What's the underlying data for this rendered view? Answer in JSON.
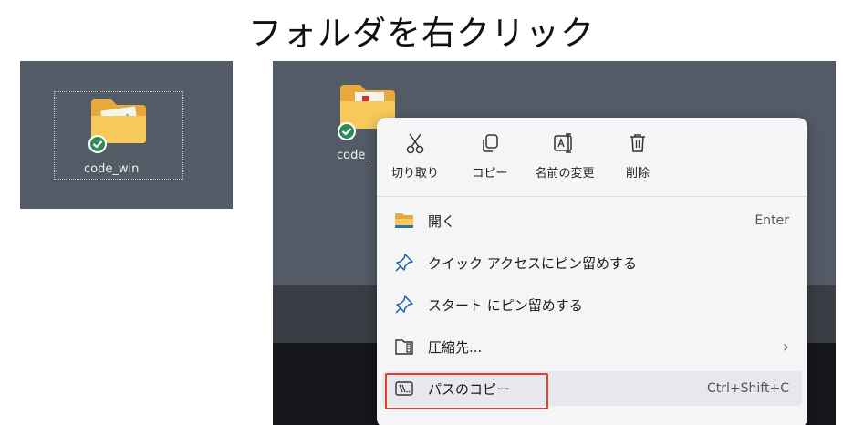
{
  "title": "フォルダを右クリック",
  "left_panel": {
    "folder_label": "code_win",
    "folder_icon": "folder-icon",
    "sync_icon": "check-badge-icon"
  },
  "right_panel": {
    "folder_label": "code_",
    "context_menu": {
      "actions": [
        {
          "label": "切り取り",
          "icon": "scissors-icon"
        },
        {
          "label": "コピー",
          "icon": "copy-icon"
        },
        {
          "label": "名前の変更",
          "icon": "rename-icon"
        },
        {
          "label": "削除",
          "icon": "trash-icon"
        }
      ],
      "items": [
        {
          "label": "開く",
          "shortcut": "Enter",
          "icon": "folder-open-icon"
        },
        {
          "label": "クイック アクセスにピン留めする",
          "shortcut": "",
          "icon": "pin-icon"
        },
        {
          "label": "スタート にピン留めする",
          "shortcut": "",
          "icon": "pin-icon"
        },
        {
          "label": "圧縮先...",
          "shortcut": "",
          "icon": "zip-folder-icon",
          "submenu": "›"
        },
        {
          "label": "パスのコピー",
          "shortcut": "Ctrl+Shift+C",
          "icon": "copy-path-icon"
        }
      ]
    }
  },
  "colors": {
    "desktop": "#535b66",
    "menu_bg": "#f4f5f7",
    "highlight_box": "#e0402f",
    "folder": "#f2c14e",
    "check": "#2e8b57"
  }
}
